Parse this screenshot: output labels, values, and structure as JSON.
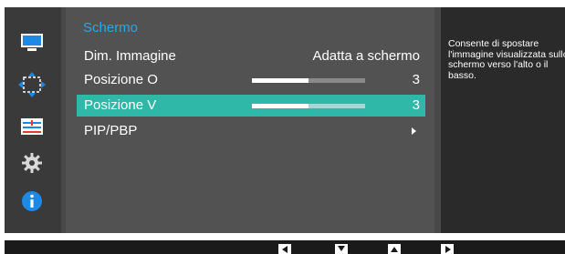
{
  "sidebar": {
    "items": [
      {
        "icon": "monitor-icon",
        "active": false
      },
      {
        "icon": "position-arrows-icon",
        "active": true
      },
      {
        "icon": "settings-panel-icon",
        "active": false
      },
      {
        "icon": "gear-icon",
        "active": false
      },
      {
        "icon": "info-icon",
        "active": false
      }
    ]
  },
  "menu": {
    "title": "Schermo",
    "items": [
      {
        "label": "Dim. Immagine",
        "value": "Adatta a schermo"
      },
      {
        "label": "Posizione O",
        "value": "3",
        "level_fraction": 0.5
      },
      {
        "label": "Posizione V",
        "value": "3",
        "level_fraction": 0.5,
        "selected": true
      },
      {
        "label": "PIP/PBP",
        "submenu": true
      }
    ]
  },
  "help": {
    "text": "Consente di spostare l'immagine visualizzata sullo schermo verso l'alto o il basso."
  },
  "keys": [
    "left-arrow-icon",
    "down-arrow-icon",
    "up-arrow-icon",
    "right-arrow-icon"
  ],
  "colors": {
    "accent_title": "#2aa7e8",
    "selection": "#2fb7a8",
    "info_icon": "#1e88e5"
  }
}
